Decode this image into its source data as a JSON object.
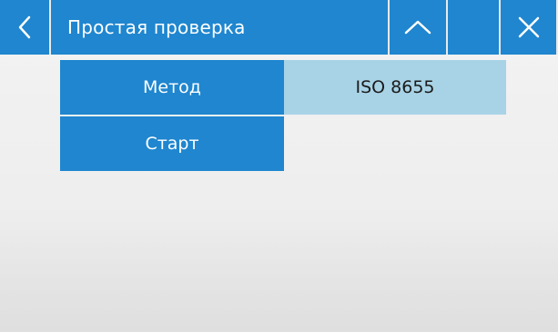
{
  "header": {
    "title": "Простая проверка",
    "back_icon": "chevron-left-icon",
    "up_icon": "chevron-up-icon",
    "close_icon": "close-icon",
    "accent_color": "#1f86cf"
  },
  "rows": [
    {
      "label": "Метод",
      "value": "ISO 8655",
      "value_bg": "#a8d3e6"
    },
    {
      "label": "Старт"
    }
  ]
}
